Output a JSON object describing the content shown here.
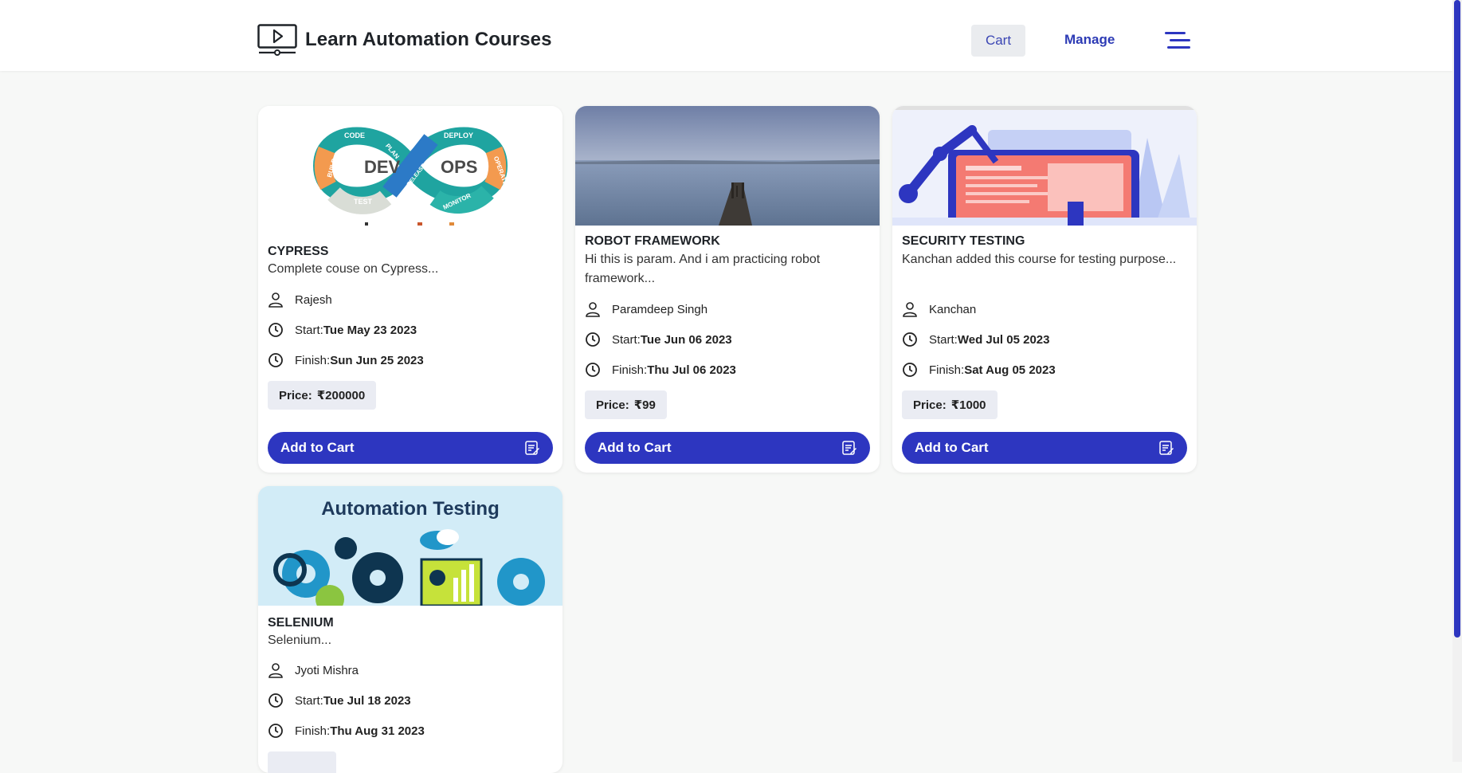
{
  "header": {
    "brand": "Learn Automation Courses",
    "cart_label": "Cart",
    "manage_label": "Manage",
    "logo_icon": "video-player-icon",
    "menu_icon": "hamburger-menu-icon"
  },
  "colors": {
    "accent": "#2d36c0",
    "background": "#f7f8f7",
    "price_bg": "#eaecf3"
  },
  "courses": [
    {
      "title": "CYPRESS",
      "description": "Complete couse on Cypress...",
      "author": "Rajesh",
      "start_label": "Start:",
      "start": "Tue May 23 2023",
      "finish_label": "Finish:",
      "finish": "Sun Jun 25 2023",
      "price_label": "Price:",
      "price": "₹200000",
      "button": "Add to Cart",
      "image_text": {
        "dev": "DEV",
        "ops": "OPS",
        "code": "CODE",
        "plan": "PLAN",
        "build": "BUILD",
        "release": "RELEASE",
        "deploy": "DEPLOY",
        "operate": "OPERATE",
        "test": "TEST",
        "monitor": "MONITOR"
      }
    },
    {
      "title": "ROBOT FRAMEWORK",
      "description": "Hi this is param. And i am practicing robot framework...",
      "author": "Paramdeep Singh",
      "start_label": "Start:",
      "start": "Tue Jun 06 2023",
      "finish_label": "Finish:",
      "finish": "Thu Jul 06 2023",
      "price_label": "Price:",
      "price": "₹99",
      "button": "Add to Cart"
    },
    {
      "title": "SECURITY TESTING",
      "description": "Kanchan added this course for testing purpose...",
      "author": "Kanchan",
      "start_label": "Start:",
      "start": "Wed Jul 05 2023",
      "finish_label": "Finish:",
      "finish": "Sat Aug 05 2023",
      "price_label": "Price:",
      "price": "₹1000",
      "button": "Add to Cart"
    },
    {
      "title": "SELENIUM",
      "description": "Selenium...",
      "author": "Jyoti Mishra",
      "start_label": "Start:",
      "start": "Tue Jul 18 2023",
      "finish_label": "Finish:",
      "finish": "Thu Aug 31 2023",
      "image_text": {
        "banner": "Automation Testing"
      }
    }
  ]
}
